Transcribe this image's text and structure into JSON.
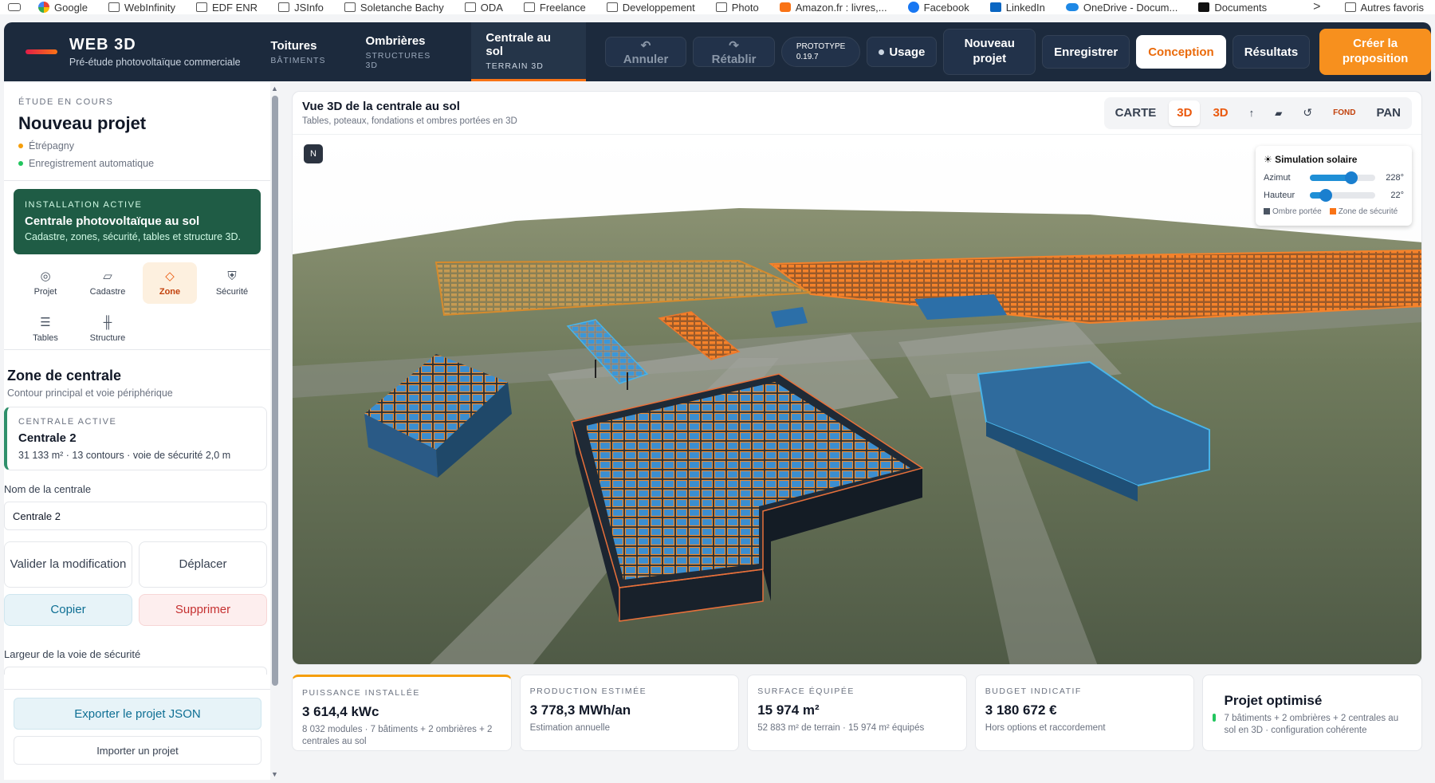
{
  "bookmarks": [
    {
      "icon": "google-icon",
      "label": "Google",
      "cls": "g"
    },
    {
      "icon": "folder-icon",
      "label": "WebInfinity",
      "cls": ""
    },
    {
      "icon": "folder-icon",
      "label": "EDF ENR",
      "cls": ""
    },
    {
      "icon": "folder-icon",
      "label": "JSInfo",
      "cls": ""
    },
    {
      "icon": "folder-icon",
      "label": "Soletanche Bachy",
      "cls": ""
    },
    {
      "icon": "folder-icon",
      "label": "ODA",
      "cls": ""
    },
    {
      "icon": "folder-icon",
      "label": "Freelance",
      "cls": ""
    },
    {
      "icon": "folder-icon",
      "label": "Developpement",
      "cls": ""
    },
    {
      "icon": "folder-icon",
      "label": "Photo",
      "cls": ""
    },
    {
      "icon": "amazon-icon",
      "label": "Amazon.fr : livres,...",
      "cls": "am"
    },
    {
      "icon": "facebook-icon",
      "label": "Facebook",
      "cls": "fb"
    },
    {
      "icon": "linkedin-icon",
      "label": "LinkedIn",
      "cls": "li"
    },
    {
      "icon": "onedrive-icon",
      "label": "OneDrive - Docum...",
      "cls": "od"
    },
    {
      "icon": "documents-icon",
      "label": "Documents",
      "cls": "doc"
    }
  ],
  "bookmarks_more": ">",
  "bookmarks_other": "Autres favoris",
  "brand": {
    "title": "WEB 3D",
    "subtitle": "Pré-étude photovoltaïque commerciale"
  },
  "tabs": [
    {
      "label": "Toitures",
      "sub": "Bâtiments"
    },
    {
      "label": "Ombrières",
      "sub": "Structures 3D"
    },
    {
      "label": "Centrale au sol",
      "sub": "Terrain 3D"
    }
  ],
  "actions": {
    "undo": "↶ Annuler",
    "redo": "↷ Rétablir",
    "proto_label": "PROTOTYPE",
    "proto_version": "0.19.7",
    "usage": "Usage",
    "new_project": "Nouveau projet",
    "save": "Enregistrer",
    "design": "Conception",
    "results": "Résultats",
    "proposal": "Créer la proposition"
  },
  "project": {
    "eyebrow": "Étude en cours",
    "title": "Nouveau projet",
    "location": "Étrépagny",
    "autosave": "Enregistrement automatique",
    "colors": {
      "location": "#f59e0b",
      "autosave": "#22c55e"
    }
  },
  "installation": {
    "eyebrow": "Installation active",
    "title": "Centrale photovoltaïque au sol",
    "desc": "Cadastre, zones, sécurité, tables et structure 3D."
  },
  "tools": [
    {
      "label": "Projet",
      "glyph": "◎",
      "icon": "target-icon"
    },
    {
      "label": "Cadastre",
      "glyph": "▱",
      "icon": "parcel-icon"
    },
    {
      "label": "Zone",
      "glyph": "◇",
      "icon": "diamond-icon"
    },
    {
      "label": "Sécurité",
      "glyph": "⛨",
      "icon": "shield-icon"
    },
    {
      "label": "Tables",
      "glyph": "☰",
      "icon": "tables-icon"
    },
    {
      "label": "Structure",
      "glyph": "╫",
      "icon": "structure-icon"
    }
  ],
  "selected_tool": "Zone",
  "zone": {
    "title": "Zone de centrale",
    "subtitle": "Contour principal et voie périphérique"
  },
  "centrale": {
    "eyebrow": "Centrale active",
    "title": "Centrale 2",
    "details": "31 133 m² · 13 contours · voie de sécurité 2,0 m"
  },
  "form": {
    "name_label": "Nom de la centrale",
    "name_value": "Centrale 2",
    "validate": "Valider la modification",
    "move": "Déplacer",
    "copy": "Copier",
    "delete": "Supprimer",
    "lane_label": "Largeur de la voie de sécurité"
  },
  "export": {
    "json": "Exporter le projet JSON",
    "import": "Importer un projet"
  },
  "view": {
    "title": "Vue 3D de la centrale au sol",
    "subtitle": "Tables, poteaux, fondations et ombres portées en 3D",
    "north": "N",
    "modes": [
      "CARTE",
      "3D",
      "3D",
      "↑",
      "▰",
      "↺",
      "FOND",
      "PAN"
    ]
  },
  "sim": {
    "title": "☀ Simulation solaire",
    "azimut_label": "Azimut",
    "azimut_value": "228°",
    "azimut_fraction": 0.63,
    "hauteur_label": "Hauteur",
    "hauteur_value": "22°",
    "hauteur_fraction": 0.24,
    "legend_shadow": "Ombre portée",
    "legend_zone": "Zone de sécurité",
    "colors": {
      "shadow": "#4b5563",
      "zone": "#f97316"
    }
  },
  "kpis": [
    {
      "eyebrow": "Puissance installée",
      "value": "3 614,4 kWc",
      "sub": "8 032 modules · 7 bâtiments + 2 ombrières + 2 centrales au sol"
    },
    {
      "eyebrow": "Production estimée",
      "value": "3 778,3 MWh/an",
      "sub": "Estimation annuelle"
    },
    {
      "eyebrow": "Surface équipée",
      "value": "15 974 m²",
      "sub": "52 883 m² de terrain · 15 974 m² équipés"
    },
    {
      "eyebrow": "Budget indicatif",
      "value": "3 180 672 €",
      "sub": "Hors options et raccordement"
    }
  ],
  "optimized": {
    "title": "Projet optimisé",
    "sub": "7 bâtiments + 2 ombrières + 2 centrales au sol en 3D · configuration cohérente"
  },
  "colors": {
    "header": "#1c2a3d",
    "accent": "#f97316",
    "green_card": "#1f5c45",
    "panel_blue": "#2f86c4"
  }
}
